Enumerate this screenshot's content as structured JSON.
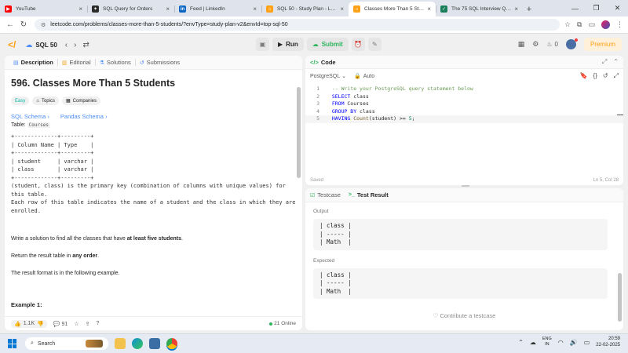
{
  "browser": {
    "tabs": [
      {
        "title": "YouTube",
        "color": "#ff0000",
        "glyph": "▶",
        "active": false
      },
      {
        "title": "SQL Query for Orders",
        "color": "#2b2b2b",
        "glyph": "✦",
        "active": false
      },
      {
        "title": "Feed | LinkedIn",
        "color": "#0a66c2",
        "glyph": "in",
        "active": false
      },
      {
        "title": "SQL 50 - Study Plan - LeetCode",
        "color": "#ffa116",
        "glyph": "⌂",
        "active": false
      },
      {
        "title": "Classes More Than 5 Students",
        "color": "#ffa116",
        "glyph": "⌂",
        "active": true
      },
      {
        "title": "The 75 SQL Interview Questions",
        "color": "#1a7f5a",
        "glyph": "✓",
        "active": false
      }
    ],
    "url": "leetcode.com/problems/classes-more-than-5-students/?envType=study-plan-v2&envId=top-sql-50"
  },
  "header": {
    "plan": "SQL 50",
    "run_label": "Run",
    "submit_label": "Submit",
    "streak": "0",
    "premium_label": "Premium"
  },
  "left": {
    "tabs": [
      "Description",
      "Editorial",
      "Solutions",
      "Submissions"
    ],
    "title": "596. Classes More Than 5 Students",
    "tags": {
      "difficulty": "Easy",
      "topics": "Topics",
      "companies": "Companies"
    },
    "links": {
      "sql_schema": "SQL Schema",
      "pandas_schema": "Pandas Schema"
    },
    "table_prefix": "Table:",
    "table_name": "Courses",
    "schema_block": "+-------------+---------+\n| Column Name | Type    |\n+-------------+---------+\n| student     | varchar |\n| class       | varchar |\n+-------------+---------+",
    "pk_text": "(student, class) is the primary key (combination of columns with unique values) for this table.",
    "row_text": "Each row of this table indicates the name of a student and the class in which they are enrolled.",
    "task_pre": "Write a solution to find all the classes that have ",
    "task_bold": "at least five students",
    "task_post": ".",
    "order_pre": "Return the result table in ",
    "order_bold": "any order",
    "order_post": ".",
    "format_text": "The result format is in the following example.",
    "example_heading": "Example 1:",
    "likes": "1.1K",
    "comments": "91",
    "online": "21 Online"
  },
  "code": {
    "heading": "Code",
    "language": "PostgreSQL",
    "auto_label": "Auto",
    "lines": [
      {
        "n": "1",
        "parts": [
          {
            "t": "  -- Write your PostgreSQL query statement below",
            "c": "cm"
          }
        ]
      },
      {
        "n": "2",
        "parts": [
          {
            "t": "  SELECT",
            "c": "kw"
          },
          {
            "t": " class",
            "c": "tx"
          }
        ]
      },
      {
        "n": "3",
        "parts": [
          {
            "t": "  FROM",
            "c": "kw"
          },
          {
            "t": " Courses",
            "c": "tx"
          }
        ]
      },
      {
        "n": "4",
        "parts": [
          {
            "t": "  GROUP BY",
            "c": "kw"
          },
          {
            "t": " class",
            "c": "tx"
          }
        ]
      },
      {
        "n": "5",
        "parts": [
          {
            "t": "  HAVING",
            "c": "kw"
          },
          {
            "t": " ",
            "c": "tx"
          },
          {
            "t": "Count",
            "c": "fn"
          },
          {
            "t": "(student) >= ",
            "c": "tx"
          },
          {
            "t": "5",
            "c": "nm"
          },
          {
            "t": ";",
            "c": "tx"
          }
        ]
      }
    ],
    "saved": "Saved",
    "position": "Ln 5, Col 28"
  },
  "result": {
    "tabs": [
      "Testcase",
      "Test Result"
    ],
    "output_label": "Output",
    "output_table": "| class |\n| ----- |\n| Math  |",
    "expected_label": "Expected",
    "expected_table": "| class |\n| ----- |\n| Math  |",
    "contribute": "Contribute a testcase"
  },
  "taskbar": {
    "search_placeholder": "Search",
    "lang_top": "ENG",
    "lang_bottom": "IN",
    "time": "20:59",
    "date": "22-02-2025"
  }
}
